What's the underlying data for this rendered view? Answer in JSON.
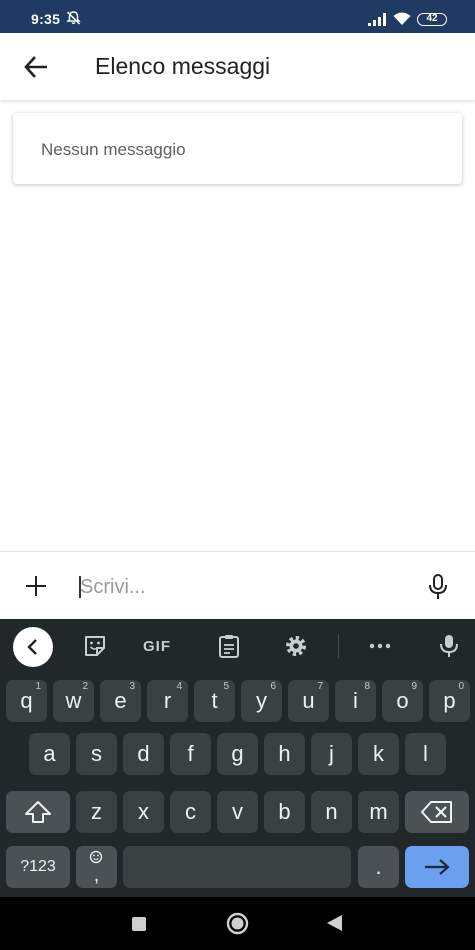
{
  "status_bar": {
    "time": "9:35",
    "battery": "42",
    "icons": [
      "bell-off-icon",
      "signal-icon",
      "wifi-icon",
      "battery-icon"
    ]
  },
  "app_bar": {
    "back_icon": "arrow-left-icon",
    "title": "Elenco messaggi"
  },
  "messages": {
    "empty_text": "Nessun messaggio"
  },
  "composer": {
    "add_icon": "plus-icon",
    "placeholder": "Scrivi...",
    "value": "",
    "mic_icon": "microphone-icon"
  },
  "keyboard": {
    "toolbar": {
      "collapse_icon": "chevron-left-icon",
      "sticker_icon": "sticker-icon",
      "gif_label": "GIF",
      "clipboard_icon": "clipboard-icon",
      "settings_icon": "gear-icon",
      "more_icon": "more-horizontal-icon",
      "voice_icon": "microphone-icon"
    },
    "row1": [
      {
        "k": "q",
        "h": "1"
      },
      {
        "k": "w",
        "h": "2"
      },
      {
        "k": "e",
        "h": "3"
      },
      {
        "k": "r",
        "h": "4"
      },
      {
        "k": "t",
        "h": "5"
      },
      {
        "k": "y",
        "h": "6"
      },
      {
        "k": "u",
        "h": "7"
      },
      {
        "k": "i",
        "h": "8"
      },
      {
        "k": "o",
        "h": "9"
      },
      {
        "k": "p",
        "h": "0"
      }
    ],
    "row2": [
      "a",
      "s",
      "d",
      "f",
      "g",
      "h",
      "j",
      "k",
      "l"
    ],
    "row3": [
      "z",
      "x",
      "c",
      "v",
      "b",
      "n",
      "m"
    ],
    "shift_icon": "shift-icon",
    "backspace_icon": "backspace-icon",
    "symbols_label": "?123",
    "comma_label": ",",
    "emoji_icon": "emoji-icon",
    "period_label": ".",
    "enter_icon": "arrow-right-icon",
    "colors": {
      "key": "#3b4043",
      "key_dark": "#4b5154",
      "enter": "#6aa0ee",
      "background": "#22272a"
    }
  },
  "nav_bar": {
    "icons": [
      "recents-icon",
      "home-icon",
      "back-triangle-icon"
    ]
  }
}
